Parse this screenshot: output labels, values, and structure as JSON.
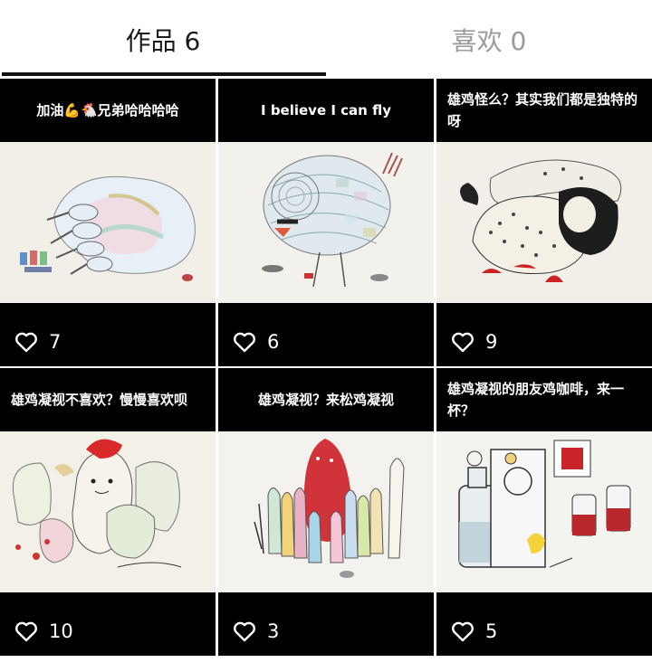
{
  "tabs": {
    "works_label": "作品 6",
    "likes_label": "喜欢 0"
  },
  "posts": [
    {
      "caption": "加油💪🐔兄弟哈哈哈哈",
      "likes": "7",
      "image_alt": "drawing-inflated-creature"
    },
    {
      "caption": "I believe I can fly",
      "likes": "6",
      "image_alt": "drawing-patchwork-bird"
    },
    {
      "caption": "雄鸡怪么？其实我们都是独特的呀",
      "likes": "9",
      "image_alt": "drawing-spotted-creatures"
    },
    {
      "caption": "雄鸡凝视不喜欢？慢慢喜欢呗",
      "likes": "10",
      "image_alt": "drawing-chicken-group"
    },
    {
      "caption": "雄鸡凝视？来松鸡凝视",
      "likes": "3",
      "image_alt": "drawing-red-figure-crowd"
    },
    {
      "caption": "雄鸡凝视的朋友鸡咖啡，来一杯？",
      "likes": "5",
      "image_alt": "drawing-coffee-bottles"
    }
  ],
  "colors": {
    "tab_active": "#1a1a1a",
    "tab_inactive": "#9a9a9a",
    "card_background": "#000000"
  },
  "icons": {
    "like": "heart-outline-icon"
  }
}
